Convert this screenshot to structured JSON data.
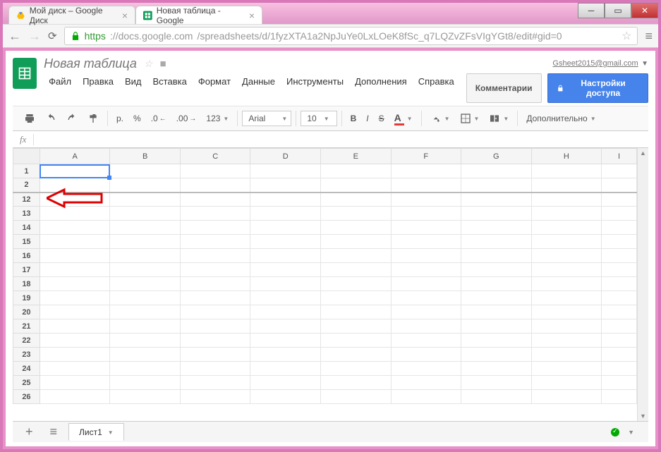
{
  "window": {
    "tabs": [
      {
        "label": "Мой диск – Google Диск",
        "icon": "drive-icon"
      },
      {
        "label": "Новая таблица - Google",
        "icon": "sheets-icon"
      }
    ],
    "url_proto": "https",
    "url_host": "://docs.google.com",
    "url_path": "/spreadsheets/d/1fyzXTA1a2NpJuYe0LxLOeK8fSc_q7LQZvZFsVIgYGt8/edit#gid=0"
  },
  "header": {
    "doc_title": "Новая таблица",
    "user_email": "Gsheet2015@gmail.com",
    "comments_label": "Комментарии",
    "share_label": "Настройки доступа"
  },
  "menubar": {
    "file": "Файл",
    "edit": "Правка",
    "view": "Вид",
    "insert": "Вставка",
    "format": "Формат",
    "data": "Данные",
    "tools": "Инструменты",
    "addons": "Дополнения",
    "help": "Справка"
  },
  "toolbar": {
    "currency": "р.",
    "percent": "%",
    "dec_dec": ".0",
    "dec_inc": ".00",
    "num_fmt": "123",
    "font": "Arial",
    "size": "10",
    "more": "Дополнительно"
  },
  "fx": {
    "label": "fx",
    "value": ""
  },
  "sheet": {
    "columns": [
      "A",
      "B",
      "C",
      "D",
      "E",
      "F",
      "G",
      "H",
      "I"
    ],
    "rows": [
      "1",
      "2",
      "12",
      "13",
      "14",
      "15",
      "16",
      "17",
      "18",
      "19",
      "20",
      "21",
      "22",
      "23",
      "24",
      "25",
      "26"
    ],
    "selected": "A1"
  },
  "sheet_tabs": {
    "tab1": "Лист1"
  }
}
